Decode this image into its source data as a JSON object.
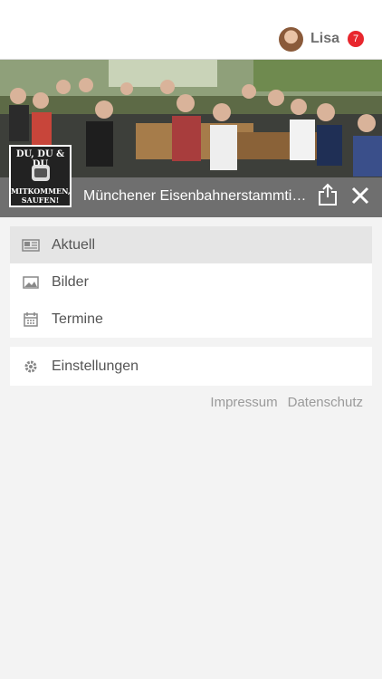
{
  "header": {
    "user_name": "Lisa",
    "notification_count": "7"
  },
  "group": {
    "title": "Münchener Eisenbahnerstammtisch",
    "logo_text_top": "DU, DU & DU",
    "logo_text_bottom_1": "MITKOMMEN,",
    "logo_text_bottom_2": "SAUFEN!"
  },
  "menu": {
    "items": [
      {
        "label": "Aktuell",
        "icon": "newspaper-icon",
        "active": true
      },
      {
        "label": "Bilder",
        "icon": "image-icon",
        "active": false
      },
      {
        "label": "Termine",
        "icon": "calendar-icon",
        "active": false
      }
    ],
    "settings": {
      "label": "Einstellungen",
      "icon": "gear-icon"
    }
  },
  "footer": {
    "impressum": "Impressum",
    "datenschutz": "Datenschutz"
  },
  "colors": {
    "badge": "#e8262d",
    "active_item": "#e5e5e5",
    "title_bar": "#646464"
  }
}
